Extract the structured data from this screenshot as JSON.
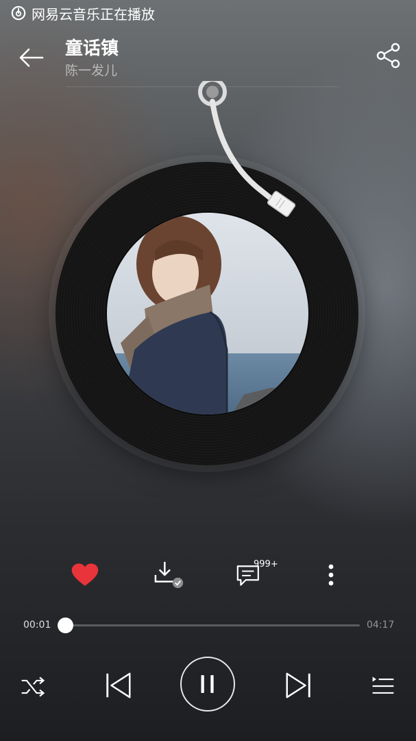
{
  "status_bar": {
    "text": "网易云音乐正在播放",
    "icon": "netease-cloud-music-icon"
  },
  "header": {
    "title": "童话镇",
    "artist": "陈一发儿",
    "back_icon": "arrow-left-icon",
    "share_icon": "share-icon"
  },
  "player": {
    "album_art": "album-cover-image",
    "like_icon": "heart-icon",
    "download_icon": "download-done-icon",
    "comment_icon": "comment-icon",
    "comment_count": "999+",
    "more_icon": "more-vertical-icon"
  },
  "progress": {
    "current_time": "00:01",
    "total_time": "04:17",
    "fraction": 0.004
  },
  "playback": {
    "shuffle_icon": "shuffle-icon",
    "prev_icon": "skip-previous-icon",
    "pause_icon": "pause-icon",
    "next_icon": "skip-next-icon",
    "playlist_icon": "playlist-icon"
  },
  "colors": {
    "accent_red": "#e8343a",
    "text_white": "#ffffff"
  }
}
